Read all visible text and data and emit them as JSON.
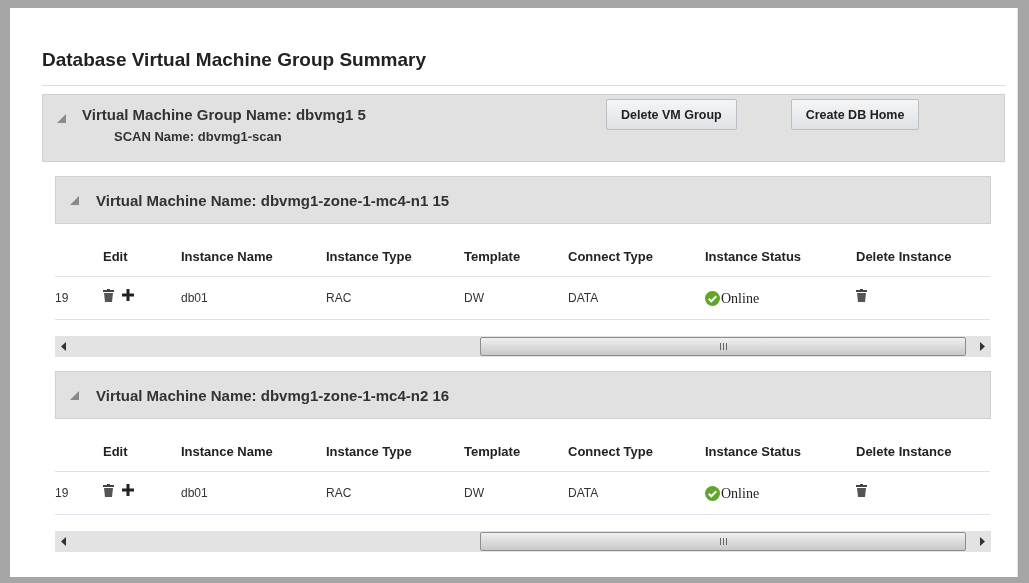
{
  "title": "Database Virtual Machine Group Summary",
  "group": {
    "expanded": true,
    "name_label": "Virtual Machine Group Name: dbvmg1 5",
    "scan_label": "SCAN Name: dbvmg1-scan",
    "buttons": [
      "Delete VM Group",
      "Create DB Home"
    ]
  },
  "virtual_machines": [
    {
      "expanded": true,
      "title": "Virtual Machine Name: dbvmg1-zone-1-mc4-n1 15",
      "table": {
        "columns": [
          "",
          "Edit",
          "Instance Name",
          "Instance Type",
          "Template",
          "Connect Type",
          "Instance Status",
          "Delete Instance"
        ],
        "rows": [
          {
            "number": "19",
            "instance_name": "db01",
            "instance_type": "RAC",
            "template": "DW",
            "connect_type": "DATA",
            "status": {
              "kind": "online",
              "text": "Online"
            }
          }
        ]
      }
    },
    {
      "expanded": true,
      "title": "Virtual Machine Name: dbvmg1-zone-1-mc4-n2 16",
      "table": {
        "columns": [
          "",
          "Edit",
          "Instance Name",
          "Instance Type",
          "Template",
          "Connect Type",
          "Instance Status",
          "Delete Instance"
        ],
        "rows": [
          {
            "number": "19",
            "instance_name": "db01",
            "instance_type": "RAC",
            "template": "DW",
            "connect_type": "DATA",
            "status": {
              "kind": "online",
              "text": "Online"
            }
          }
        ]
      }
    }
  ]
}
